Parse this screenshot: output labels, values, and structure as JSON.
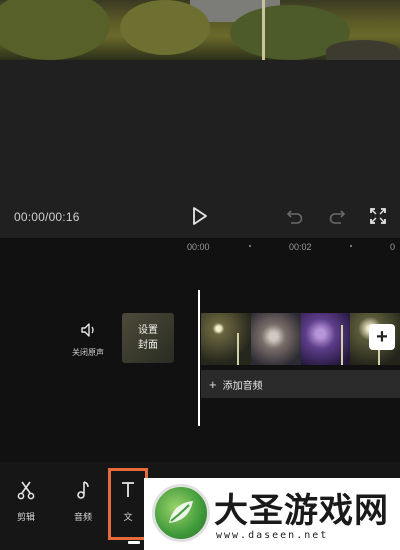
{
  "player": {
    "time": "00:00/00:16"
  },
  "timeline": {
    "ruler": [
      "00:00",
      "00:02",
      "0"
    ],
    "mute_label": "关闭原声",
    "cover_line1": "设置",
    "cover_line2": "封面",
    "add_audio_label": "添加音频",
    "add_clip_symbol": "+",
    "audio_plus_symbol": "+"
  },
  "toolbar": {
    "items": [
      {
        "label": "剪辑",
        "icon": "scissors-icon"
      },
      {
        "label": "音频",
        "icon": "music-note-icon"
      },
      {
        "label": "文",
        "icon": "text-icon"
      }
    ]
  },
  "watermark": {
    "title": "大圣游戏网",
    "url": "www.daseen.net",
    "logo": "dasheng-logo-icon"
  },
  "colors": {
    "accent": "#e76a3a",
    "background": "#1c1c1e"
  }
}
